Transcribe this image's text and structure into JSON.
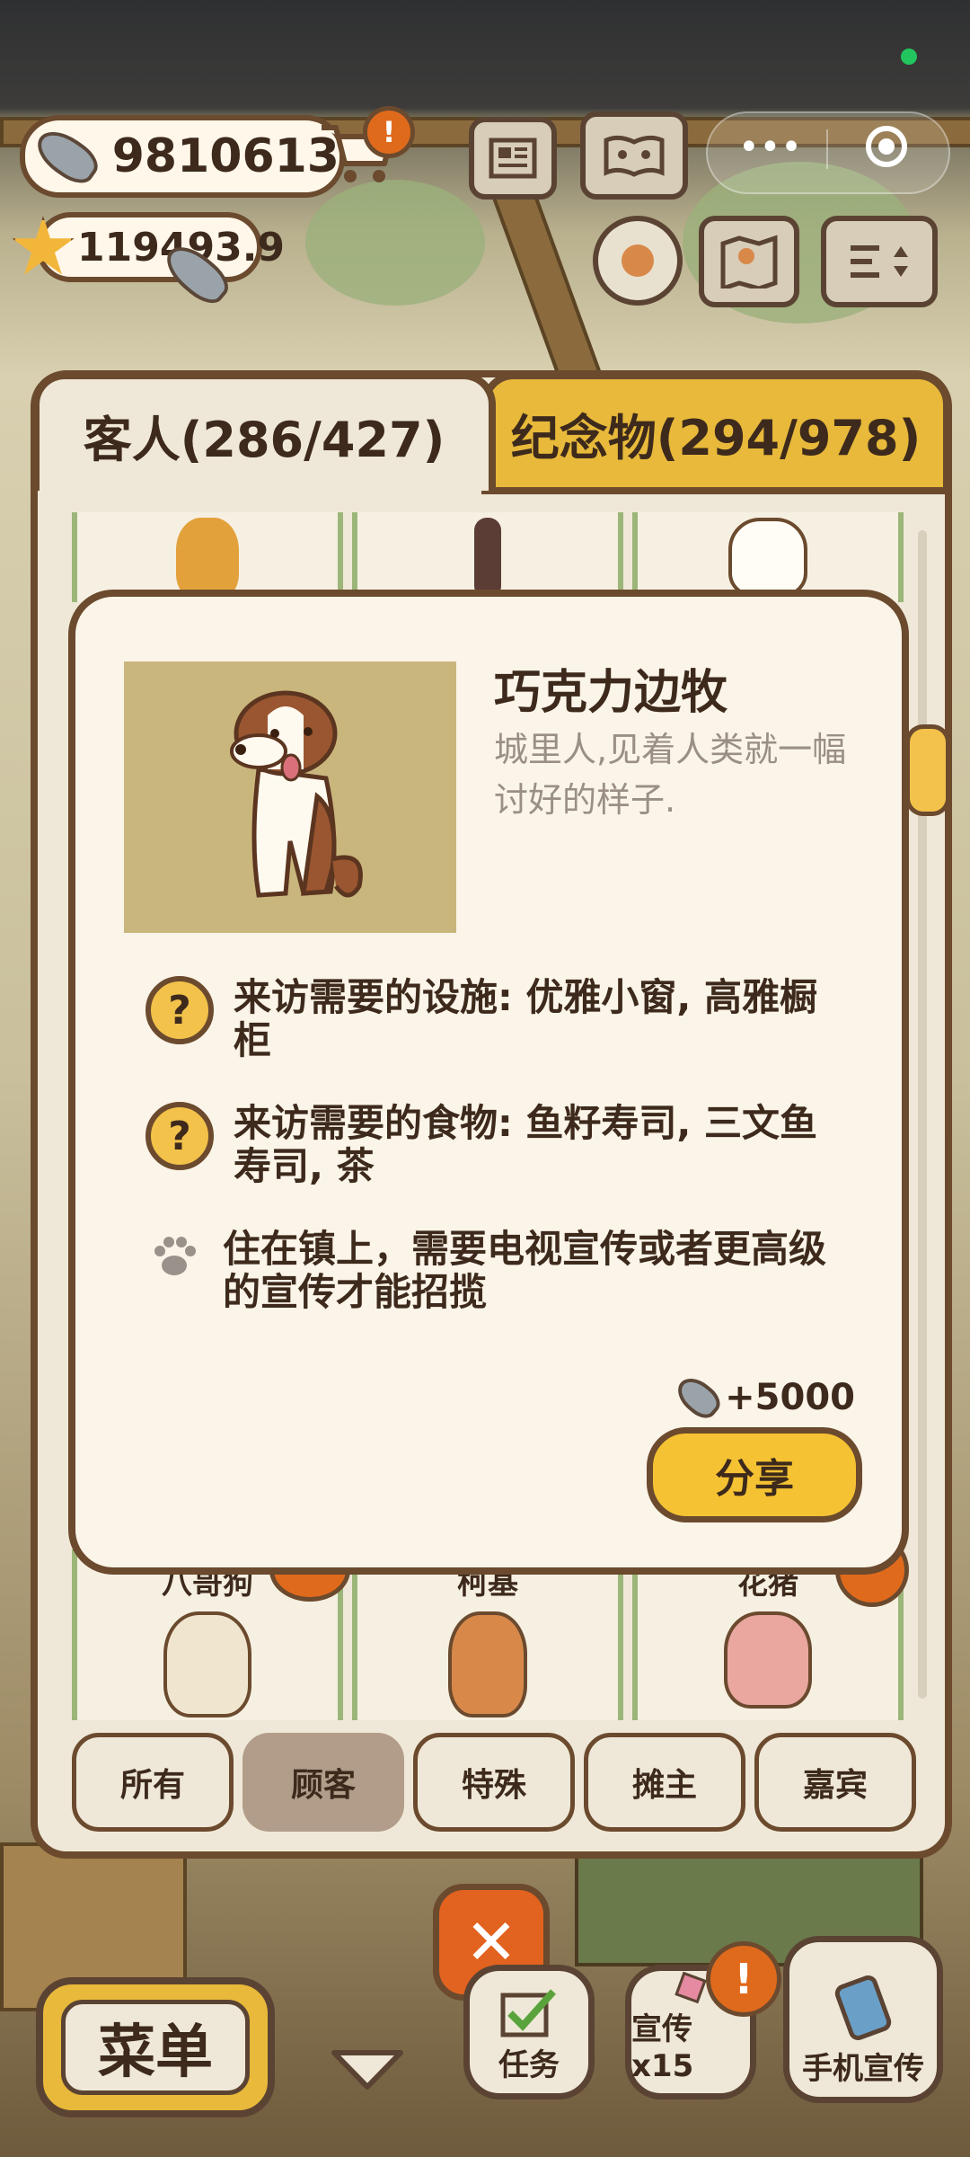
{
  "status": {
    "dot_color": "#22c55e"
  },
  "currency": {
    "fish_amount": "9810613",
    "star_amount": "119493.9"
  },
  "icons": {
    "fish": "fish-icon",
    "star": "star-icon",
    "cart": "cart-icon",
    "alert": "!"
  },
  "top_buttons": [
    "newspaper-icon",
    "paw-book-icon",
    "gear-icon",
    "map-icon",
    "sort-icon"
  ],
  "tabs": {
    "guests": "客人(286/427)",
    "souvenirs": "纪念物(294/978)"
  },
  "grid_bottom": [
    {
      "name": "八哥狗"
    },
    {
      "name": "柯基"
    },
    {
      "name": "花猪"
    }
  ],
  "detail": {
    "name": "巧克力边牧",
    "description": "城里人,见着人类就一幅讨好的样子.",
    "requirements": [
      {
        "icon": "?",
        "text": "来访需要的设施: 优雅小窗, 高雅橱柜"
      },
      {
        "icon": "?",
        "text": "来访需要的食物: 鱼籽寿司, 三文鱼寿司, 茶"
      },
      {
        "icon": "paw",
        "text": "住在镇上，需要电视宣传或者更高级的宣传才能招揽"
      }
    ],
    "reward": "+5000",
    "share_label": "分享"
  },
  "filters": [
    {
      "label": "所有",
      "active": false
    },
    {
      "label": "顾客",
      "active": true
    },
    {
      "label": "特殊",
      "active": false
    },
    {
      "label": "摊主",
      "active": false
    },
    {
      "label": "嘉宾",
      "active": false
    }
  ],
  "close_symbol": "✕",
  "bottom": {
    "menu_label": "菜单",
    "tasks_label": "任务",
    "promo_label": "宣传x15",
    "phone_label": "手机宣传"
  },
  "colors": {
    "accent": "#f5c233",
    "border": "#6b4a2e",
    "alert": "#e06a1c"
  }
}
